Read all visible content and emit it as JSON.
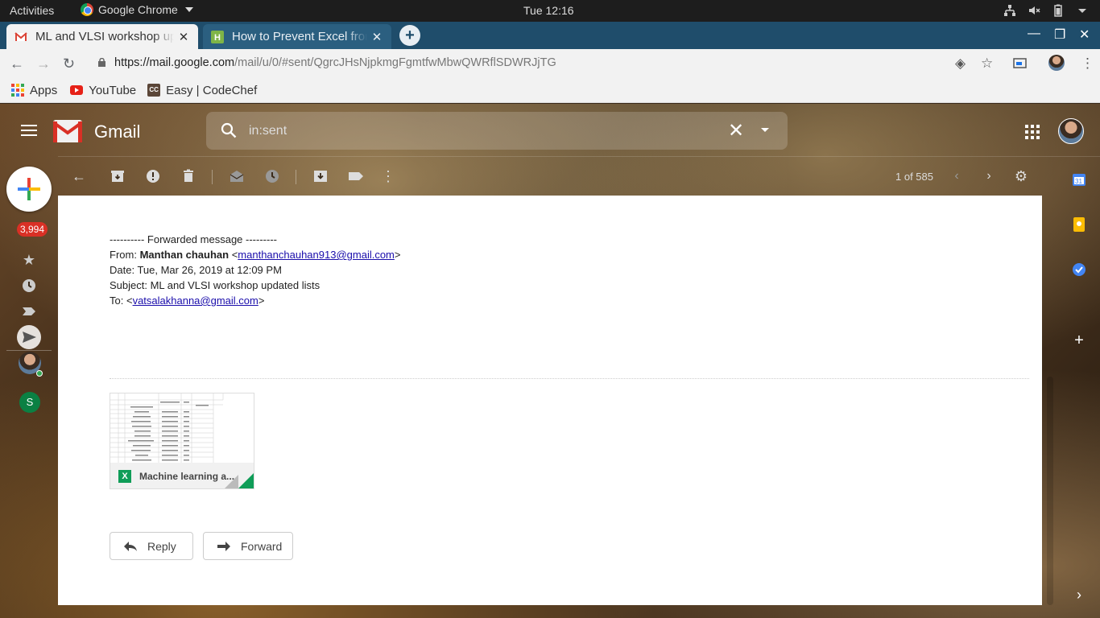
{
  "os_bar": {
    "activities": "Activities",
    "app_name": "Google Chrome",
    "clock": "Tue 12:16"
  },
  "browser": {
    "tabs": [
      {
        "title": "ML and VLSI workshop updated lists",
        "favicon": "gmail-icon",
        "active": true
      },
      {
        "title": "How to Prevent Excel from",
        "favicon": "howtogeek-icon",
        "active": false
      }
    ],
    "url_host": "https://mail.google.com",
    "url_path": "/mail/u/0/#sent/QgrcJHsNjpkmgFgmtfwMbwQWRflSDWRJjTG",
    "bookmarks": [
      {
        "label": "Apps",
        "icon": "apps-grid-icon"
      },
      {
        "label": "YouTube",
        "icon": "youtube-icon"
      },
      {
        "label": "Easy | CodeChef",
        "icon": "codechef-icon"
      }
    ]
  },
  "gmail": {
    "brand": "Gmail",
    "search_value": "in:sent",
    "unread_count": "3,994",
    "pager": "1 of 585",
    "rail_avatar_letter": "S",
    "message": {
      "fwd_header": "---------- Forwarded message ---------",
      "from_label": "From: ",
      "from_name": "Manthan chauhan",
      "from_email": "manthanchauhan913@gmail.com",
      "date_line": "Date: Tue, Mar 26, 2019 at 12:09 PM",
      "subject_line": "Subject: ML and VLSI workshop updated lists",
      "to_label": "To: ",
      "to_email": "vatsalakhanna@gmail.com"
    },
    "attachment": {
      "name": "Machine learning a...",
      "type_letter": "X"
    },
    "actions": {
      "reply": "Reply",
      "forward": "Forward"
    }
  },
  "colors": {
    "tab_strip": "#1f4d6b",
    "badge": "#d93025",
    "excel_green": "#0f9d58",
    "link": "#1a0dab"
  }
}
